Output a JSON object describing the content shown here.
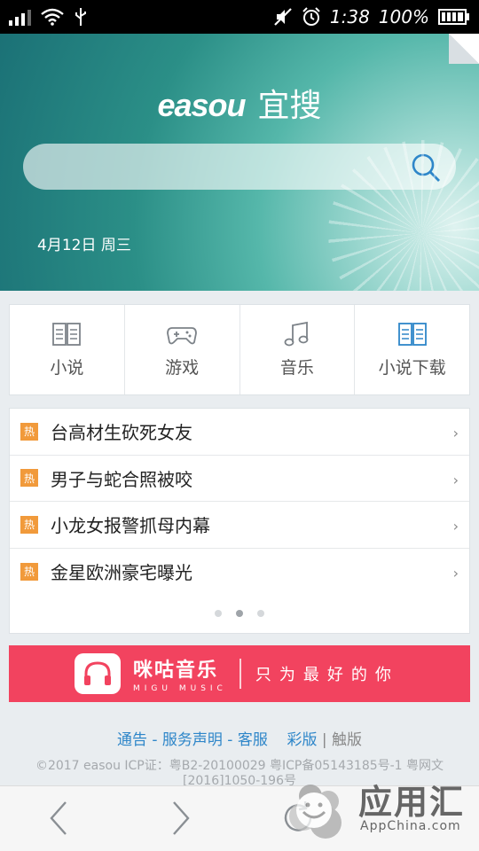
{
  "status_bar": {
    "time": "1:38",
    "battery": "100%"
  },
  "hero": {
    "brand_en": "easou",
    "brand_cn": "宜搜",
    "search_placeholder": "",
    "date": "4月12日 周三"
  },
  "categories": [
    {
      "label": "小说",
      "icon": "book-icon"
    },
    {
      "label": "游戏",
      "icon": "gamepad-icon"
    },
    {
      "label": "音乐",
      "icon": "music-note-icon"
    },
    {
      "label": "小说下载",
      "icon": "book-icon"
    }
  ],
  "news": {
    "badge": "热",
    "items": [
      "台高材生砍死女友",
      "男子与蛇合照被咬",
      "小龙女报警抓母内幕",
      "金星欧洲豪宅曝光"
    ],
    "pager": {
      "pages": 3,
      "active": 2
    }
  },
  "banner": {
    "brand_cn": "咪咕音乐",
    "brand_en": "MIGU MUSIC",
    "slogan": "只为最好的你",
    "color": "#f2435f"
  },
  "footer": {
    "notice": "通告",
    "service_statement": "服务声明",
    "customer_service": "客服",
    "color_version": "彩版",
    "touch_version": "触版",
    "copyright_line1": "©2017 easou ICP证：粤B2-20100029 粤ICP备05143185号-1 粤网文",
    "copyright_line2": "[2016]1050-196号"
  },
  "watermark": {
    "text": "应用汇",
    "sub": "AppChina.com"
  },
  "colors": {
    "accent_blue": "#2e86c9",
    "hot_badge": "#f19a3b"
  }
}
